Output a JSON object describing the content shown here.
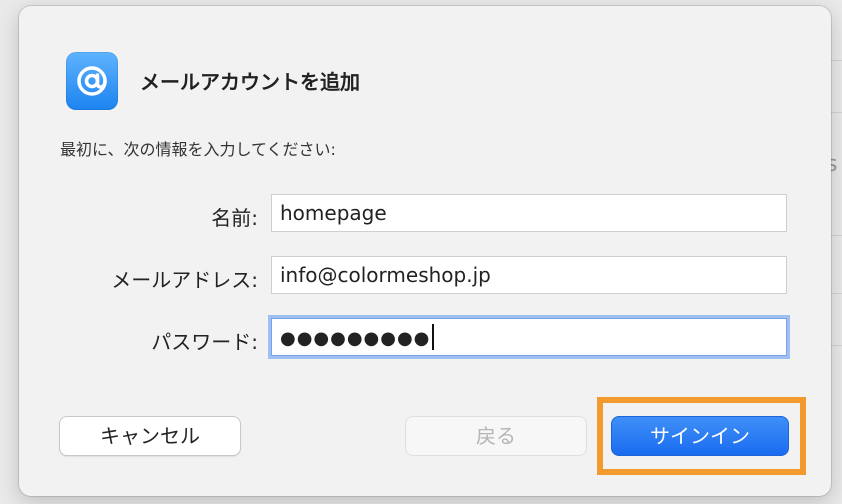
{
  "dialog": {
    "title": "メールアカウントを追加",
    "instruction": "最初に、次の情報を入力してください:"
  },
  "form": {
    "name_label": "名前:",
    "name_value": "homepage",
    "email_label": "メールアドレス:",
    "email_value": "info@colormeshop.jp",
    "password_label": "パスワード:",
    "password_masked": "●●●●●●●●●"
  },
  "buttons": {
    "cancel": "キャンセル",
    "back": "戻る",
    "sign_in": "サインイン"
  },
  "background": {
    "partial_text": "s"
  },
  "colors": {
    "accent": "#1a6cf0",
    "highlight": "#f29a2e",
    "app_icon": "#2a8cf2"
  }
}
